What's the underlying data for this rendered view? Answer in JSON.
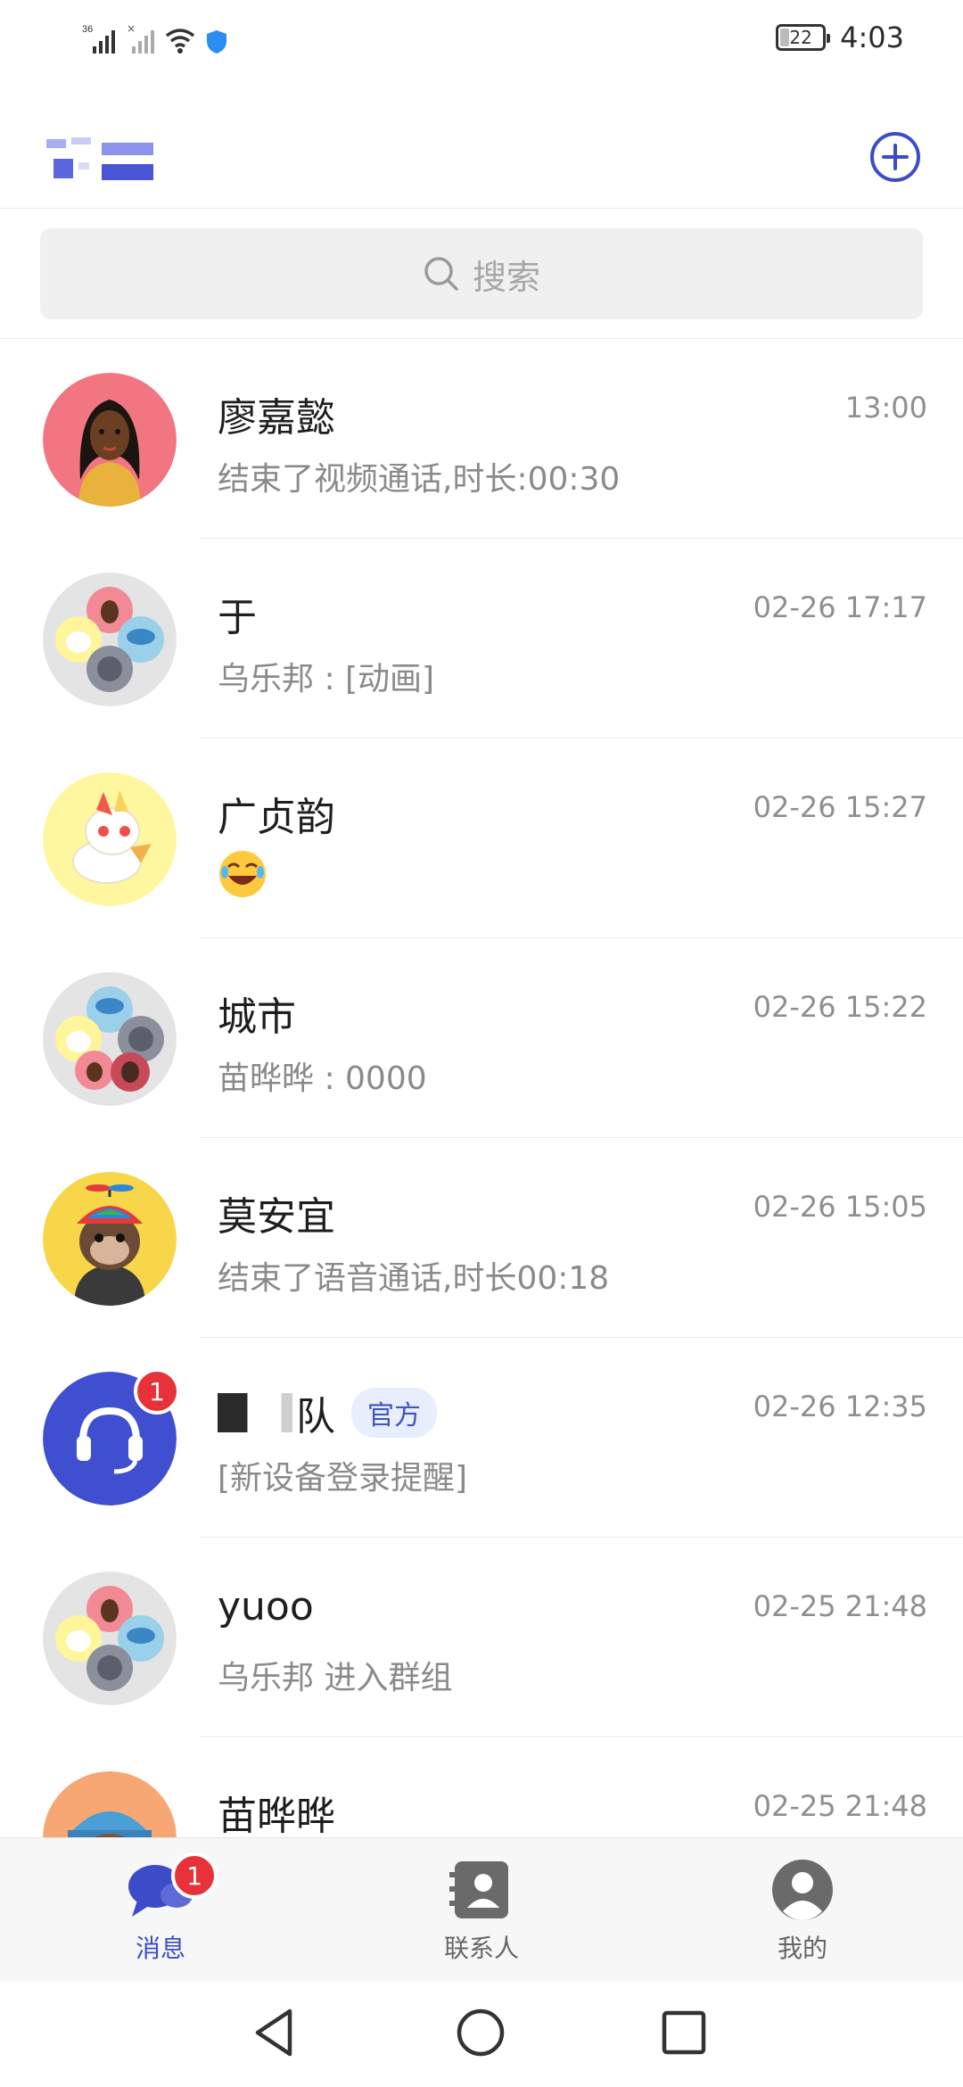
{
  "status_bar": {
    "network": "36",
    "time": "4:03",
    "battery": "22"
  },
  "header": {
    "add_icon": "plus-circle-icon"
  },
  "search": {
    "placeholder": "搜索"
  },
  "conversations": [
    {
      "name": "廖嘉懿",
      "time": "13:00",
      "preview": "结束了视频通话,时长:00:30",
      "avatar": "woman-portrait"
    },
    {
      "name": "于",
      "time": "02-26 17:17",
      "preview": "乌乐邦 : [动画]",
      "avatar": "group-collage"
    },
    {
      "name": "广贞韵",
      "time": "02-26 15:27",
      "preview": "",
      "preview_emoji": "laughing-face-emoji",
      "avatar": "unicorn"
    },
    {
      "name": "城市",
      "time": "02-26 15:22",
      "preview": "苗晔晔 : 0000",
      "avatar": "group-collage"
    },
    {
      "name": "莫安宜",
      "time": "02-26 15:05",
      "preview": "结束了语音通话,时长00:18",
      "avatar": "monkey-propeller-cap"
    },
    {
      "name": "队",
      "tag": "官方",
      "time": "02-26 12:35",
      "preview": "[新设备登录提醒]",
      "avatar": "headset-service",
      "badge": "1"
    },
    {
      "name": "yuoo",
      "time": "02-25 21:48",
      "preview": "乌乐邦 进入群组",
      "avatar": "group-collage"
    },
    {
      "name": "苗晔晔",
      "time": "02-25 21:48",
      "preview": "",
      "avatar": "monkey-blue-cap"
    }
  ],
  "tabs": [
    {
      "label": "消息",
      "icon": "chat-bubbles-icon",
      "active": true,
      "badge": "1"
    },
    {
      "label": "联系人",
      "icon": "contacts-book-icon",
      "active": false
    },
    {
      "label": "我的",
      "icon": "profile-icon",
      "active": false
    }
  ],
  "colors": {
    "accent": "#3c4cc8",
    "badge": "#e8323a",
    "tag_bg": "#e9eefc"
  }
}
